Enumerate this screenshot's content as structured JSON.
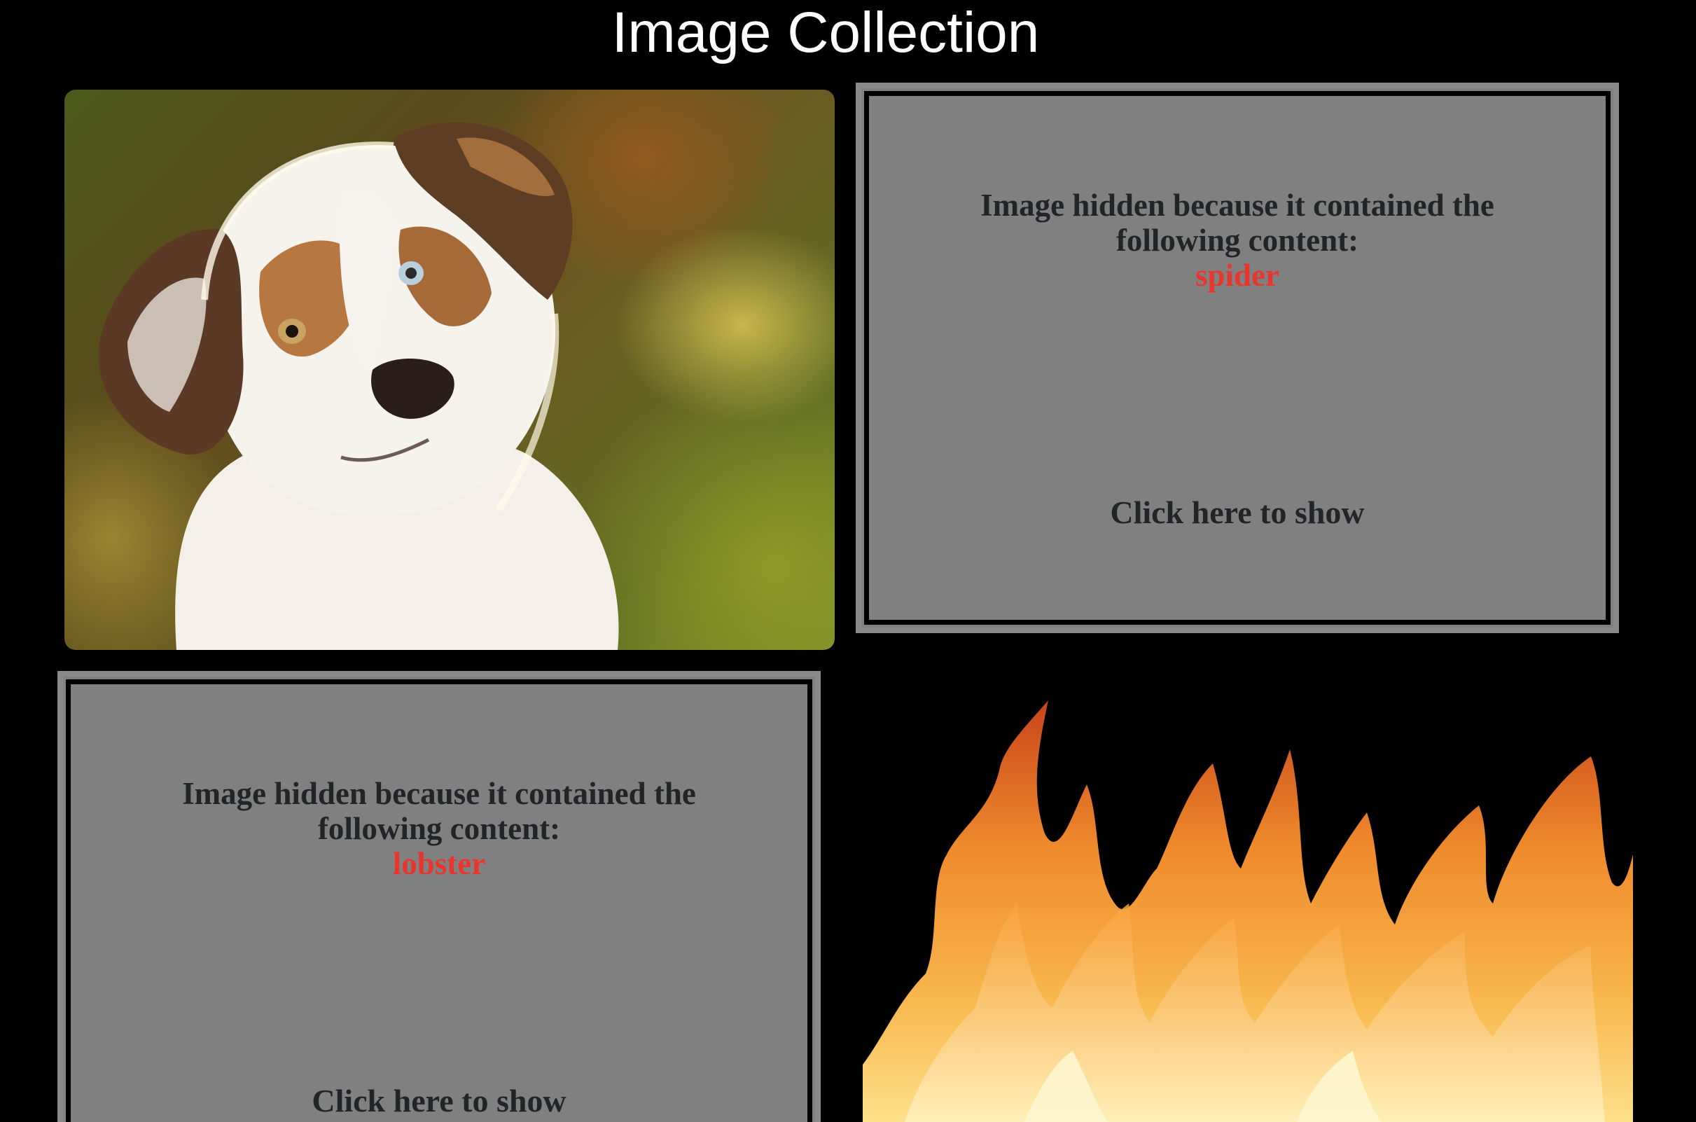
{
  "page": {
    "title": "Image Collection"
  },
  "gallery": {
    "items": [
      {
        "kind": "image",
        "depicts": "dog-photo"
      },
      {
        "kind": "hidden",
        "message_line1": "Image hidden because it contained the",
        "message_line2": "following content:",
        "reason": "spider",
        "action": "Click here to show"
      },
      {
        "kind": "hidden",
        "message_line1": "Image hidden because it contained the",
        "message_line2": "following content:",
        "reason": "lobster",
        "action": "Click here to show"
      },
      {
        "kind": "image",
        "depicts": "fire-photo"
      }
    ]
  },
  "colors": {
    "background": "#000000",
    "tile_background": "#808080",
    "tile_text": "#232428",
    "reason_text": "#e8352e"
  }
}
